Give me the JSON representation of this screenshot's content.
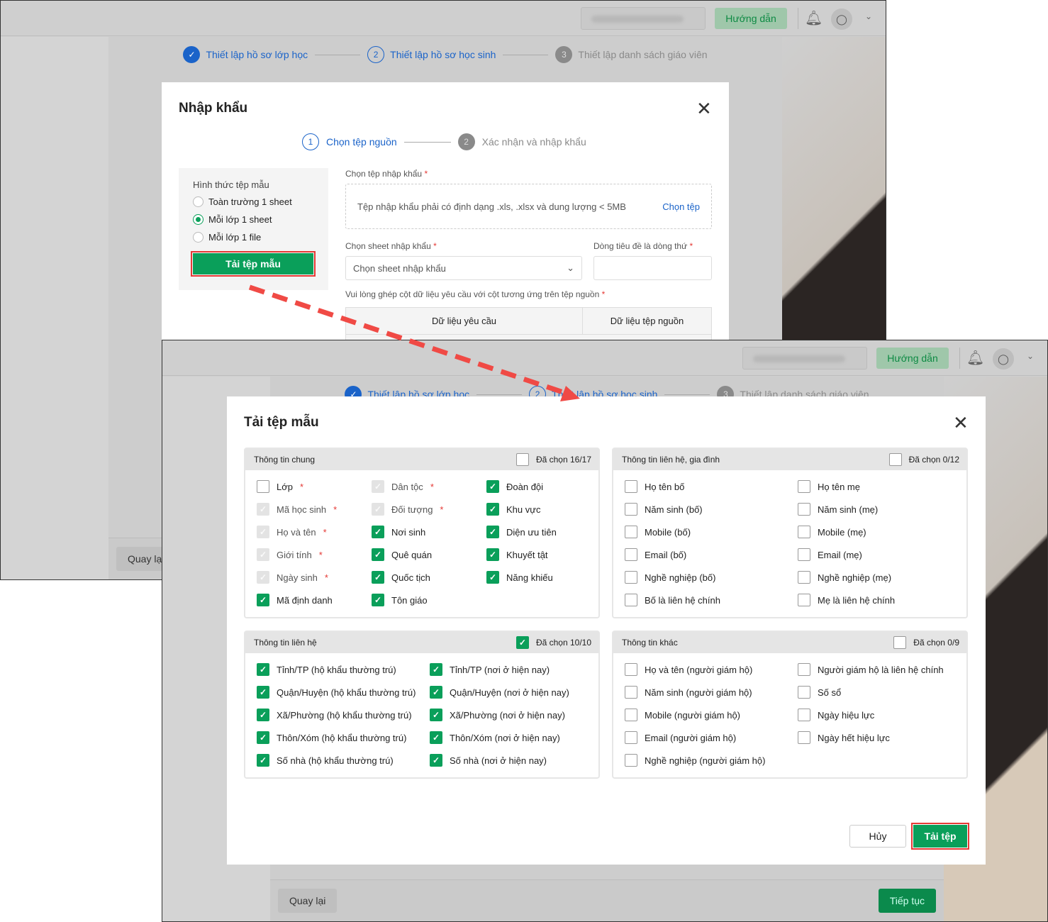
{
  "app": {
    "guide_label": "Hướng dẫn",
    "bell_icon": "bell-icon",
    "user_icon": "user-icon",
    "caret": "⌄"
  },
  "wizard": {
    "steps": [
      {
        "num": "✓",
        "label": "Thiết lập hồ sơ lớp học"
      },
      {
        "num": "2",
        "label": "Thiết lập hồ sơ học sinh"
      },
      {
        "num": "3",
        "label": "Thiết lập danh sách giáo viên"
      }
    ],
    "back_label": "Quay lại",
    "next_label": "Tiếp tục"
  },
  "import_modal": {
    "title": "Nhập khẩu",
    "close": "✕",
    "steps": [
      {
        "num": "1",
        "label": "Chọn tệp nguồn"
      },
      {
        "num": "2",
        "label": "Xác nhận và nhập khẩu"
      }
    ],
    "template_type_label": "Hình thức tệp mẫu",
    "template_options": [
      {
        "label": "Toàn trường 1 sheet",
        "selected": false
      },
      {
        "label": "Mỗi lớp 1 sheet",
        "selected": true
      },
      {
        "label": "Mỗi lớp 1 file",
        "selected": false
      }
    ],
    "download_template_label": "Tải tệp mẫu",
    "file_label": "Chọn tệp nhập khẩu",
    "file_hint": "Tệp nhập khẩu phải có định dạng .xls, .xlsx và dung lượng < 5MB",
    "choose_file_label": "Chọn tệp",
    "sheet_label": "Chọn sheet nhập khẩu",
    "sheet_placeholder": "Chọn sheet nhập khẩu",
    "header_row_label": "Dòng tiêu đề là dòng thứ",
    "mapping_label": "Vui lòng ghép cột dữ liệu yêu cầu với cột tương ứng trên tệp nguồn",
    "mapping_columns": [
      "Dữ liệu yêu cầu",
      "Dữ liệu tệp nguồn"
    ],
    "required_mark": "*"
  },
  "template_modal": {
    "title": "Tải tệp mẫu",
    "close": "✕",
    "cancel_label": "Hủy",
    "download_label": "Tải tệp",
    "sections": [
      {
        "title": "Thông tin chung",
        "count": "Đã chọn 16/17",
        "all": false,
        "cols": 3,
        "items": [
          {
            "label": "Lớp",
            "req": true,
            "state": "unchecked"
          },
          {
            "label": "Dân tộc",
            "req": true,
            "state": "disabled"
          },
          {
            "label": "Đoàn đội",
            "req": false,
            "state": "checked"
          },
          {
            "label": "Mã học sinh",
            "req": true,
            "state": "disabled"
          },
          {
            "label": "Đối tượng",
            "req": true,
            "state": "disabled"
          },
          {
            "label": "Khu vực",
            "req": false,
            "state": "checked"
          },
          {
            "label": "Họ và tên",
            "req": true,
            "state": "disabled"
          },
          {
            "label": "Nơi sinh",
            "req": false,
            "state": "checked"
          },
          {
            "label": "Diện ưu tiên",
            "req": false,
            "state": "checked"
          },
          {
            "label": "Giới tính",
            "req": true,
            "state": "disabled"
          },
          {
            "label": "Quê quán",
            "req": false,
            "state": "checked"
          },
          {
            "label": "Khuyết tật",
            "req": false,
            "state": "checked"
          },
          {
            "label": "Ngày sinh",
            "req": true,
            "state": "disabled"
          },
          {
            "label": "Quốc tịch",
            "req": false,
            "state": "checked"
          },
          {
            "label": "Năng khiếu",
            "req": false,
            "state": "checked"
          },
          {
            "label": "Mã định danh",
            "req": false,
            "state": "checked"
          },
          {
            "label": "Tôn giáo",
            "req": false,
            "state": "checked"
          }
        ]
      },
      {
        "title": "Thông tin liên hệ, gia đình",
        "count": "Đã chọn 0/12",
        "all": false,
        "cols": 2,
        "items": [
          {
            "label": "Họ tên bố",
            "state": "unchecked"
          },
          {
            "label": "Họ tên mẹ",
            "state": "unchecked"
          },
          {
            "label": "Năm sinh (bố)",
            "state": "unchecked"
          },
          {
            "label": "Năm sinh (mẹ)",
            "state": "unchecked"
          },
          {
            "label": "Mobile (bố)",
            "state": "unchecked"
          },
          {
            "label": "Mobile (mẹ)",
            "state": "unchecked"
          },
          {
            "label": "Email (bố)",
            "state": "unchecked"
          },
          {
            "label": "Email (mẹ)",
            "state": "unchecked"
          },
          {
            "label": "Nghề nghiệp (bố)",
            "state": "unchecked"
          },
          {
            "label": "Nghề nghiệp (mẹ)",
            "state": "unchecked"
          },
          {
            "label": "Bố là liên hệ chính",
            "state": "unchecked"
          },
          {
            "label": "Mẹ là liên hệ chính",
            "state": "unchecked"
          }
        ]
      },
      {
        "title": "Thông tin liên hệ",
        "count": "Đã chọn 10/10",
        "all": true,
        "cols": 2,
        "items": [
          {
            "label": "Tỉnh/TP (hộ khẩu thường trú)",
            "state": "checked"
          },
          {
            "label": "Tỉnh/TP (nơi ở hiện nay)",
            "state": "checked"
          },
          {
            "label": "Quận/Huyện (hộ khẩu thường trú)",
            "state": "checked"
          },
          {
            "label": "Quận/Huyện (nơi ở hiện nay)",
            "state": "checked"
          },
          {
            "label": "Xã/Phường (hộ khẩu thường trú)",
            "state": "checked"
          },
          {
            "label": "Xã/Phường (nơi ở hiện nay)",
            "state": "checked"
          },
          {
            "label": "Thôn/Xóm (hộ khẩu thường trú)",
            "state": "checked"
          },
          {
            "label": "Thôn/Xóm (nơi ở hiện nay)",
            "state": "checked"
          },
          {
            "label": "Số nhà (hộ khẩu thường trú)",
            "state": "checked"
          },
          {
            "label": "Số nhà (nơi ở hiện nay)",
            "state": "checked"
          }
        ]
      },
      {
        "title": "Thông tin khác",
        "count": "Đã chọn 0/9",
        "all": false,
        "cols": 2,
        "items": [
          {
            "label": "Họ và tên (người giám hộ)",
            "state": "unchecked"
          },
          {
            "label": "Người giám hộ là liên hệ chính",
            "state": "unchecked"
          },
          {
            "label": "Năm sinh (người giám hộ)",
            "state": "unchecked"
          },
          {
            "label": "Số sổ",
            "state": "unchecked"
          },
          {
            "label": "Mobile (người giám hộ)",
            "state": "unchecked"
          },
          {
            "label": "Ngày hiệu lực",
            "state": "unchecked"
          },
          {
            "label": "Email (người giám hộ)",
            "state": "unchecked"
          },
          {
            "label": "Ngày hết hiệu lực",
            "state": "unchecked"
          },
          {
            "label": "Nghề nghiệp (người giám hộ)",
            "state": "unchecked"
          }
        ]
      }
    ]
  },
  "colors": {
    "accent": "#0a9f5a",
    "primary": "#1a63c9",
    "highlight": "#e53935"
  }
}
